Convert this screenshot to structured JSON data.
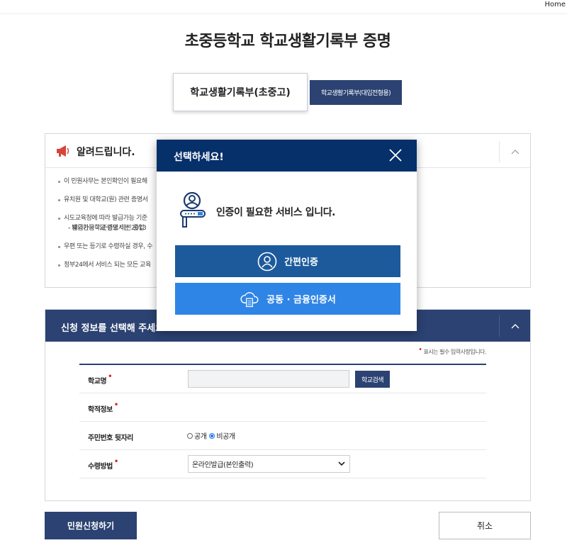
{
  "topbar": {
    "home_label": "Home"
  },
  "page": {
    "title": "초중등학교 학교생활기록부 증명"
  },
  "tabs": [
    {
      "label": "학교생활기록부(초중고)",
      "active": true
    },
    {
      "label": "학교생활기록부(대입전형용)",
      "active": false
    }
  ],
  "notice": {
    "title": "알려드립니다.",
    "items": [
      "이 민원사무는 본인확인이 필요해",
      "유치원 및 대학교(원) 관련 증명서",
      "시도교육청에 따라 발급가능 기준",
      "- 재외한국학교 증명서는 2013",
      "- 발급가능 기준년도 이전 졸업",
      "우편 또는 등기로 수령하실 경우, 수",
      "정부24에서 서비스 되는 모든 교육"
    ]
  },
  "form": {
    "header_title": "신청 정보를 선택해 주세요",
    "required_note": "표시는 필수 입력사항입니다.",
    "rows": {
      "school_label": "학교명",
      "school_search_label": "학교검색",
      "academic_label": "학적정보",
      "rrn_label": "주민번호 뒷자리",
      "rrn_options": [
        "공개",
        "비공개"
      ],
      "rrn_selected": "비공개",
      "receipt_label": "수령방법",
      "receipt_value": "온라인발급(본인출력)"
    }
  },
  "actions": {
    "submit_label": "민원신청하기",
    "cancel_label": "취소"
  },
  "modal": {
    "title": "선택하세요!",
    "message": "인증이 필요한 서비스 입니다.",
    "simple_auth_label": "간편인증",
    "cert_auth_label": "공동 · 금융인증서"
  },
  "colors": {
    "navy": "#2b4272",
    "modal_header": "#06306a",
    "simple_auth": "#1c5a9c",
    "cert_auth": "#2f85e6",
    "required": "#e0202a"
  }
}
